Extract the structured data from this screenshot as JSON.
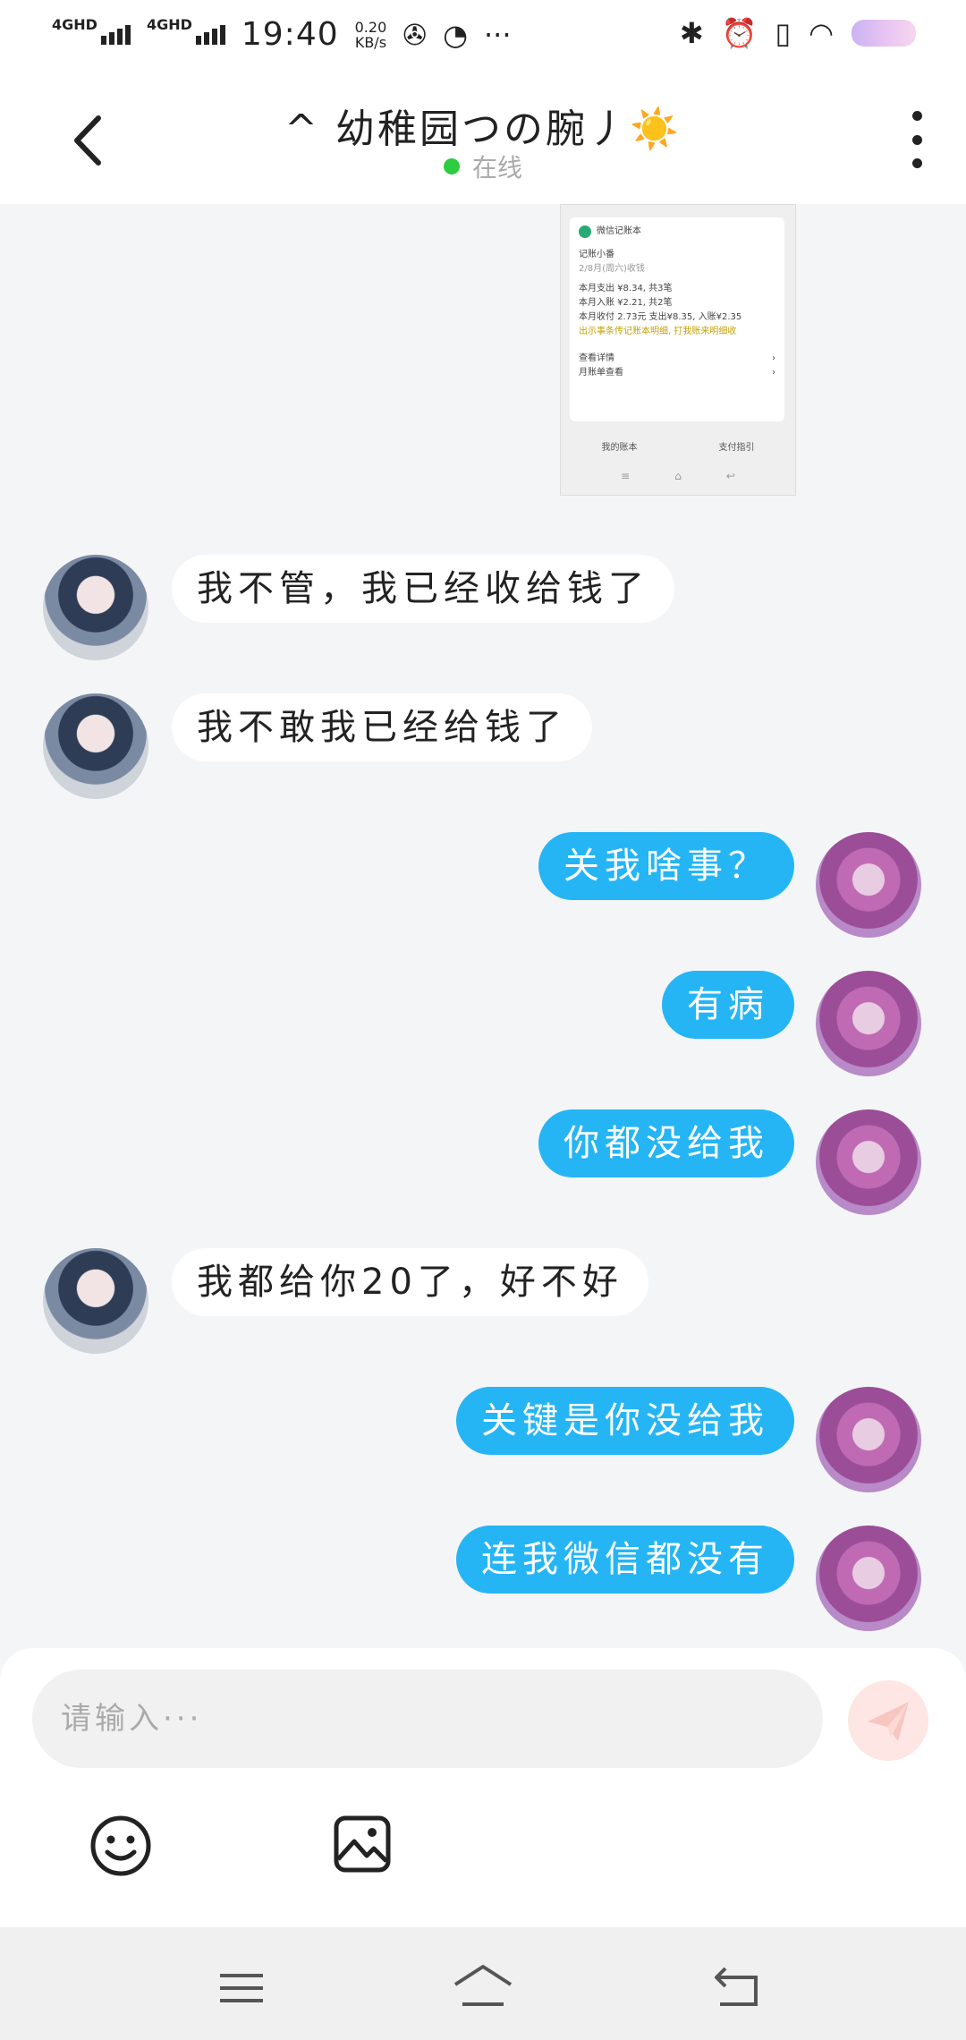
{
  "status_bar": {
    "network1": "4GHD",
    "network2": "4GHD",
    "time": "19:40",
    "speed_value": "0.20",
    "speed_unit": "KB/s",
    "more": "···"
  },
  "header": {
    "title": "^ 幼稚园つの腕丿☀️",
    "status": "在线"
  },
  "screenshot_msg": {
    "app_name": "微信记账本",
    "line1": "记账小番",
    "line2": "2/8月(周六)收钱",
    "line3": "本月支出 ¥8.34, 共3笔",
    "line4": "本月入账 ¥2.21, 共2笔",
    "line5": "本月收付 2.73元 支出¥8.35, 入账¥2.35",
    "line6": "出示事条传记账本明细, 打我账来明细收",
    "row1": "查看详情",
    "row2": "月账单查看",
    "btn1": "我的账本",
    "btn2": "支付指引"
  },
  "messages": [
    {
      "side": "left",
      "text": "我不管，我已经收给钱了"
    },
    {
      "side": "left",
      "text": "我不敢我已经给钱了"
    },
    {
      "side": "right",
      "text": "关我啥事？"
    },
    {
      "side": "right",
      "text": "有病"
    },
    {
      "side": "right",
      "text": "你都没给我"
    },
    {
      "side": "left",
      "text": "我都给你20了，好不好"
    },
    {
      "side": "right",
      "text": "关键是你没给我"
    },
    {
      "side": "right",
      "text": "连我微信都没有"
    }
  ],
  "input": {
    "placeholder": "请输入···"
  },
  "colors": {
    "accent": "#25b5f5",
    "online": "#2ecc40",
    "send_disabled": "#fde6e4"
  },
  "icons": [
    "back-icon",
    "more-icon",
    "send-icon",
    "emoji-icon",
    "image-icon",
    "menu-icon",
    "home-icon",
    "return-icon"
  ]
}
